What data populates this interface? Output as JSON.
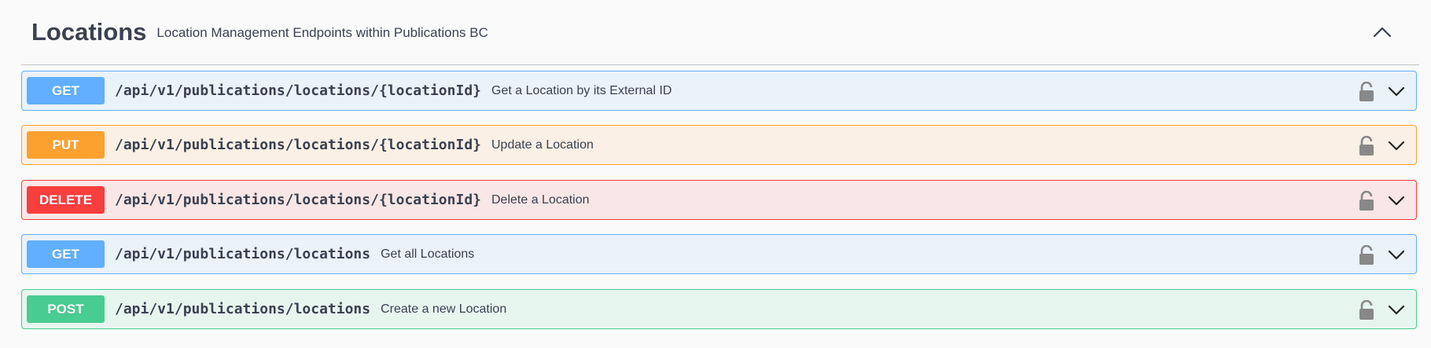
{
  "section": {
    "title": "Locations",
    "description": "Location Management Endpoints within Publications BC"
  },
  "operations": [
    {
      "method": "GET",
      "path": "/api/v1/publications/locations/{locationId}",
      "summary": "Get a Location by its External ID",
      "color": "#61affe"
    },
    {
      "method": "PUT",
      "path": "/api/v1/publications/locations/{locationId}",
      "summary": "Update a Location",
      "color": "#fca130"
    },
    {
      "method": "DELETE",
      "path": "/api/v1/publications/locations/{locationId}",
      "summary": "Delete a Location",
      "color": "#f93e3e"
    },
    {
      "method": "GET",
      "path": "/api/v1/publications/locations",
      "summary": "Get all Locations",
      "color": "#61affe"
    },
    {
      "method": "POST",
      "path": "/api/v1/publications/locations",
      "summary": "Create a new Location",
      "color": "#49cc90"
    }
  ],
  "icons": {
    "collapse": "chevron-up-icon",
    "lock": "lock-icon",
    "expand": "chevron-down-icon"
  }
}
